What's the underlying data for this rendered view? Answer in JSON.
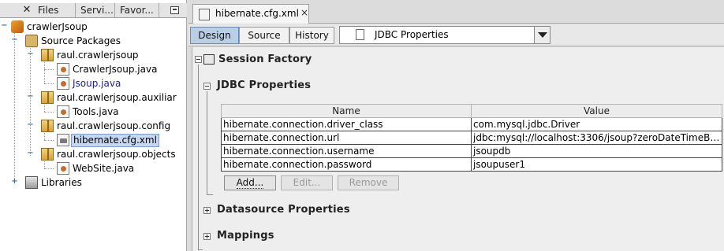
{
  "left_panel": {
    "close_symbol": "✕",
    "tabs": [
      "Files",
      "Servi...",
      "Favor..."
    ],
    "tree": {
      "project": "crawlerJsoup",
      "source_packages": "Source Packages",
      "packages": [
        {
          "name": "raul.crawlerjsoup",
          "files": [
            "CrawlerJsoup.java",
            "Jsoup.java"
          ]
        },
        {
          "name": "raul.crawlerjsoup.auxiliar",
          "files": [
            "Tools.java"
          ]
        },
        {
          "name": "raul.crawlerjsoup.config",
          "files": [
            "hibernate.cfg.xml"
          ]
        },
        {
          "name": "raul.crawlerjsoup.objects",
          "files": [
            "WebSite.java"
          ]
        }
      ],
      "libraries": "Libraries",
      "selected_file": "hibernate.cfg.xml"
    }
  },
  "editor": {
    "file_tab": {
      "label": "hibernate.cfg.xml",
      "close": "×"
    },
    "view_tabs": [
      "Design",
      "Source",
      "History"
    ],
    "active_view": "Design",
    "section_select": "JDBC Properties",
    "sections": {
      "session_factory": "Session Factory",
      "jdbc_properties": "JDBC Properties",
      "datasource_properties": "Datasource Properties",
      "mappings": "Mappings"
    },
    "table": {
      "columns": [
        "Name",
        "Value"
      ],
      "rows": [
        [
          "hibernate.connection.driver_class",
          "com.mysql.jdbc.Driver"
        ],
        [
          "hibernate.connection.url",
          "jdbc:mysql://localhost:3306/jsoup?zeroDateTimeBeh..."
        ],
        [
          "hibernate.connection.username",
          "jsoupdb"
        ],
        [
          "hibernate.connection.password",
          "jsoupuser1"
        ]
      ]
    },
    "buttons": {
      "add": "Add...",
      "edit": "Edit...",
      "remove": "Remove"
    }
  },
  "colors": {
    "selection_bg": "#c6d7ef",
    "active_view_tab": "#b8cfe6",
    "pane_bg": "#eeeeee",
    "highlight_link": "#1a1aa6"
  }
}
